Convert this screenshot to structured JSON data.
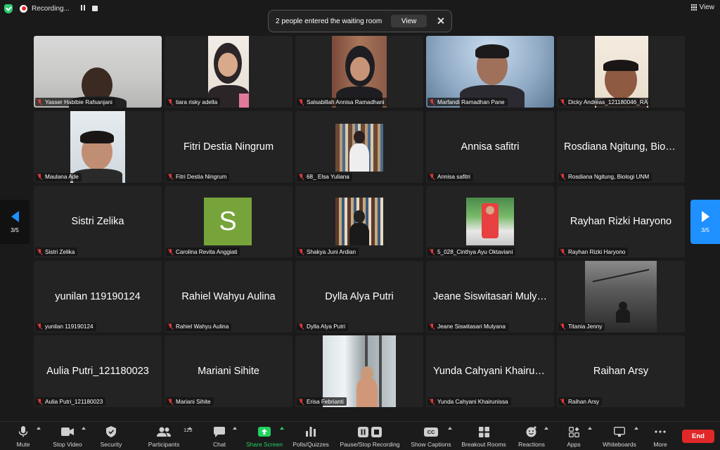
{
  "top_bar": {
    "recording_label": "Recording...",
    "view_label": "View"
  },
  "notification": {
    "text": "2 people entered the waiting room",
    "view_button": "View"
  },
  "pagination": {
    "left": "3/5",
    "right": "3/5"
  },
  "participants": [
    {
      "label": "Yasser Habibie Rafsanjani",
      "display": "",
      "video": true
    },
    {
      "label": "tiara risky adella",
      "display": "",
      "video": true
    },
    {
      "label": "Salsabillah Annisa Ramadhani",
      "display": "",
      "video": true
    },
    {
      "label": "Marfandi Ramadhan Pane",
      "display": "",
      "video": true
    },
    {
      "label": "Dicky Andreas_121180046_RA",
      "display": "",
      "video": true
    },
    {
      "label": "Maulana Ade",
      "display": "",
      "video": true
    },
    {
      "label": "Fitri Destia Ningrum",
      "display": "Fitri Destia Ningrum",
      "video": false
    },
    {
      "label": "68_ Elsa Yuliana",
      "display": "",
      "video": true
    },
    {
      "label": "Annisa safitri",
      "display": "Annisa safitri",
      "video": false
    },
    {
      "label": "Rosdiana Ngitung, Biologi UNM",
      "display": "Rosdiana Ngitung, Biolo...",
      "video": false
    },
    {
      "label": "Sistri Zelika",
      "display": "Sistri Zelika",
      "video": false
    },
    {
      "label": "Carolina Revita Anggiati",
      "display": "",
      "avatar": "S",
      "video": false
    },
    {
      "label": "Shakya Juni Ardian",
      "display": "",
      "video": true
    },
    {
      "label": "5_028_Cinthya Ayu Oktaviani",
      "display": "",
      "video": true
    },
    {
      "label": "Rayhan Rizki Haryono",
      "display": "Rayhan Rizki Haryono",
      "video": false
    },
    {
      "label": "yunilan 119190124",
      "display": "yunilan 119190124",
      "video": false
    },
    {
      "label": "Rahiel Wahyu Aulina",
      "display": "Rahiel Wahyu Aulina",
      "video": false
    },
    {
      "label": "Dylla Alya Putri",
      "display": "Dylla Alya Putri",
      "video": false
    },
    {
      "label": "Jeane Siswitasari Mulyana",
      "display": "Jeane Siswitasari Mulyana",
      "video": false
    },
    {
      "label": "Titania Jenny",
      "display": "",
      "video": true
    },
    {
      "label": "Aulia Putri_121180023",
      "display": "Aulia Putri_121180023",
      "video": false
    },
    {
      "label": "Mariani Sihite",
      "display": "Mariani Sihite",
      "video": false
    },
    {
      "label": "Erisa Febrianti",
      "display": "",
      "video": true
    },
    {
      "label": "Yunda Cahyani Khairunissa",
      "display": "Yunda Cahyani Khairuni...",
      "video": false
    },
    {
      "label": "Raihan Arsy",
      "display": "Raihan Arsy",
      "video": false
    }
  ],
  "toolbar": {
    "mute": "Mute",
    "stop_video": "Stop Video",
    "security": "Security",
    "participants": "Participants",
    "participants_count": "125",
    "chat": "Chat",
    "share_screen": "Share Screen",
    "polls": "Polls/Quizzes",
    "recording": "Pause/Stop Recording",
    "captions": "Show Captions",
    "captions_badge": "CC",
    "breakout": "Breakout Rooms",
    "reactions": "Reactions",
    "apps": "Apps",
    "whiteboards": "Whiteboards",
    "more": "More",
    "end": "End"
  },
  "colors": {
    "accent_blue": "#1e90ff",
    "share_green": "#23d160",
    "end_red": "#e02828",
    "avatar_green": "#76a43a"
  }
}
